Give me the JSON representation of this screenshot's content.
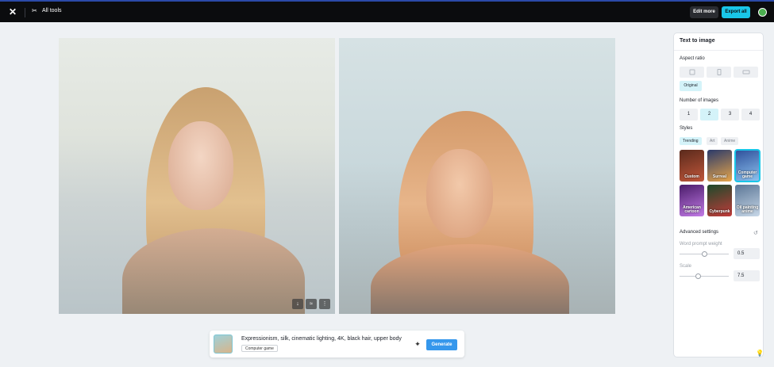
{
  "topbar": {
    "logo_icon": "capcut-logo",
    "all_tools_label": "All tools",
    "edit_more_label": "Edit more",
    "export_all_label": "Export all"
  },
  "images": [
    {
      "icon_tools": [
        "download-icon",
        "variation-icon",
        "more-icon"
      ]
    },
    {}
  ],
  "prompt": {
    "text": "Expressionism, silk, cinematic lighting, 4K, black hair, upper body",
    "style_tag": "Computer game",
    "generate_label": "Generate"
  },
  "panel": {
    "title": "Text to image",
    "aspect_ratio_label": "Aspect ratio",
    "original_label": "Original",
    "num_images_label": "Number of images",
    "num_options": [
      "1",
      "2",
      "3",
      "4"
    ],
    "num_selected": "2",
    "styles_label": "Styles",
    "style_tabs": [
      "Trending",
      "Art",
      "Anime"
    ],
    "style_cards": [
      {
        "name": "Custom",
        "colors": [
          "#5a2a1c",
          "#c0563a"
        ]
      },
      {
        "name": "Surreal",
        "colors": [
          "#2a3a6a",
          "#e7a54a"
        ]
      },
      {
        "name": "Computer game",
        "colors": [
          "#2d4f9a",
          "#8fc4f0"
        ]
      },
      {
        "name": "American cartoon",
        "colors": [
          "#4a1c6a",
          "#c27be6"
        ]
      },
      {
        "name": "Cyberpunk",
        "colors": [
          "#1c4a2a",
          "#c23a3a"
        ]
      },
      {
        "name": "Oil painting anime",
        "colors": [
          "#5b7696",
          "#c8d8e8"
        ]
      }
    ],
    "advanced_label": "Advanced settings",
    "word_prompt_weight_label": "Word prompt weight",
    "word_prompt_weight_value": "0.5",
    "scale_label": "Scale",
    "scale_value": "7.5"
  },
  "colors": {
    "accent": "#19c6e8",
    "generate": "#3597ec",
    "topbar": "#0b0c0e"
  }
}
